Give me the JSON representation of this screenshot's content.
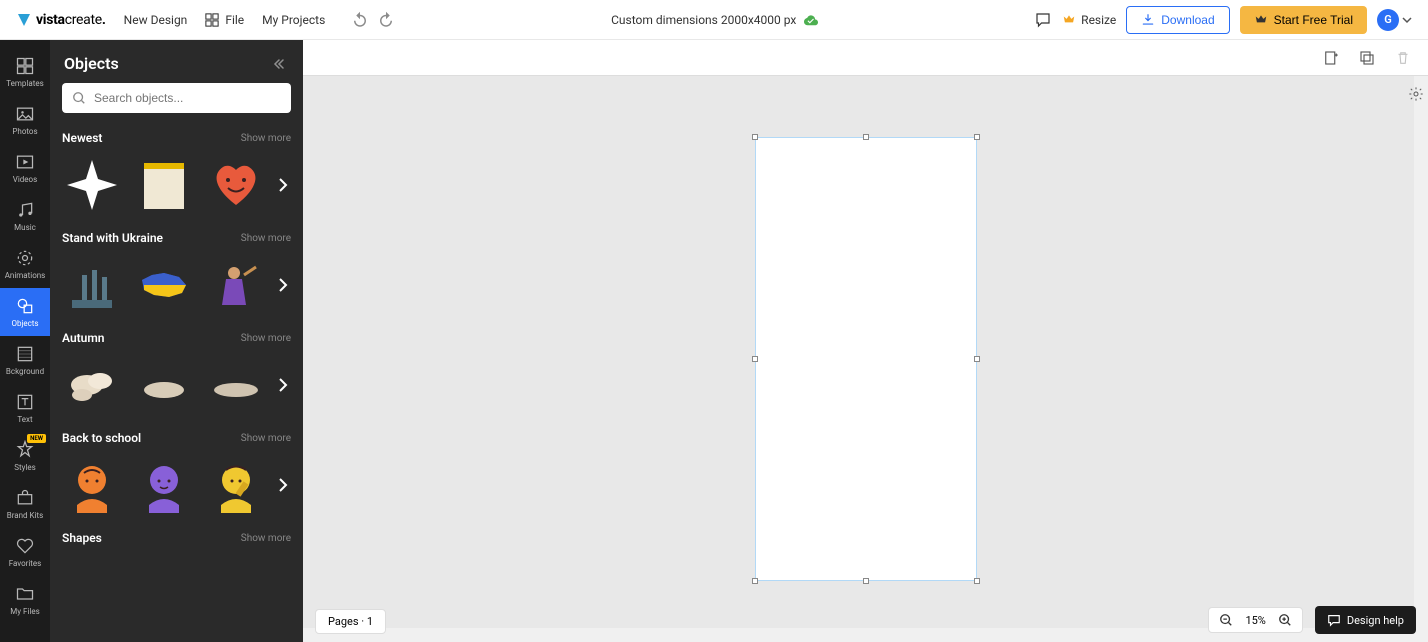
{
  "header": {
    "logo_brand": "vista",
    "logo_product": "create",
    "new_design": "New Design",
    "file": "File",
    "my_projects": "My Projects",
    "doc_title": "Custom dimensions 2000x4000 px",
    "resize": "Resize",
    "download": "Download",
    "start_trial": "Start Free Trial",
    "avatar_letter": "G"
  },
  "nav": {
    "templates": "Templates",
    "photos": "Photos",
    "videos": "Videos",
    "music": "Music",
    "animations": "Animations",
    "objects": "Objects",
    "background": "Bckground",
    "text": "Text",
    "styles": "Styles",
    "styles_badge": "NEW",
    "brand_kits": "Brand Kits",
    "favorites": "Favorites",
    "my_files": "My Files"
  },
  "panel": {
    "title": "Objects",
    "search_placeholder": "Search objects...",
    "show_more": "Show more",
    "categories": {
      "newest": "Newest",
      "ukraine": "Stand with Ukraine",
      "autumn": "Autumn",
      "back_to_school": "Back to school",
      "shapes": "Shapes"
    }
  },
  "canvas": {
    "pages_label": "Pages",
    "page_count": "1",
    "zoom": "15%",
    "design_help": "Design help"
  }
}
